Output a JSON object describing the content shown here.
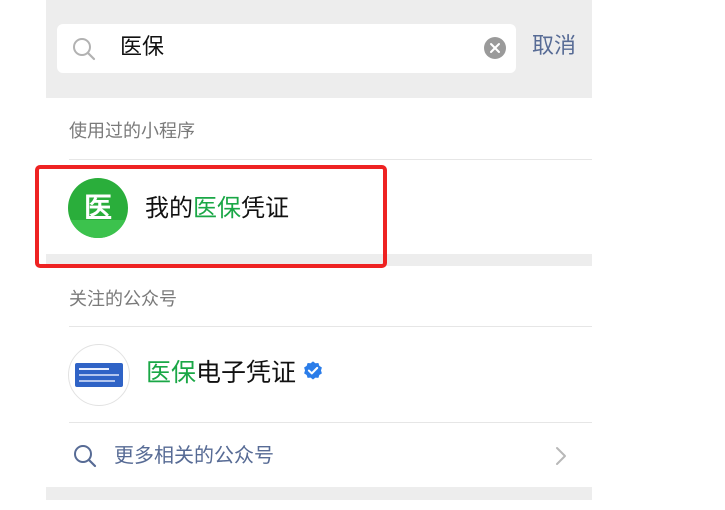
{
  "search": {
    "query": "医保",
    "cancel_label": "取消"
  },
  "mini_programs": {
    "header": "使用过的小程序",
    "items": [
      {
        "icon_glyph": "医",
        "name_prefix": "我的",
        "name_highlight": "医保",
        "name_suffix": "凭证"
      }
    ]
  },
  "official_accounts": {
    "header": "关注的公众号",
    "items": [
      {
        "name_highlight": "医保",
        "name_suffix": "电子凭证",
        "verified": true
      }
    ],
    "more_label": "更多相关的公众号"
  },
  "colors": {
    "highlight": "#1aa746",
    "link": "#576b95",
    "annotation_box": "#ee2222",
    "background": "#ededed"
  },
  "icons": [
    "search-icon",
    "clear-icon",
    "medical-insurance-icon",
    "id-card-icon",
    "verified-icon",
    "chevron-right-icon"
  ]
}
